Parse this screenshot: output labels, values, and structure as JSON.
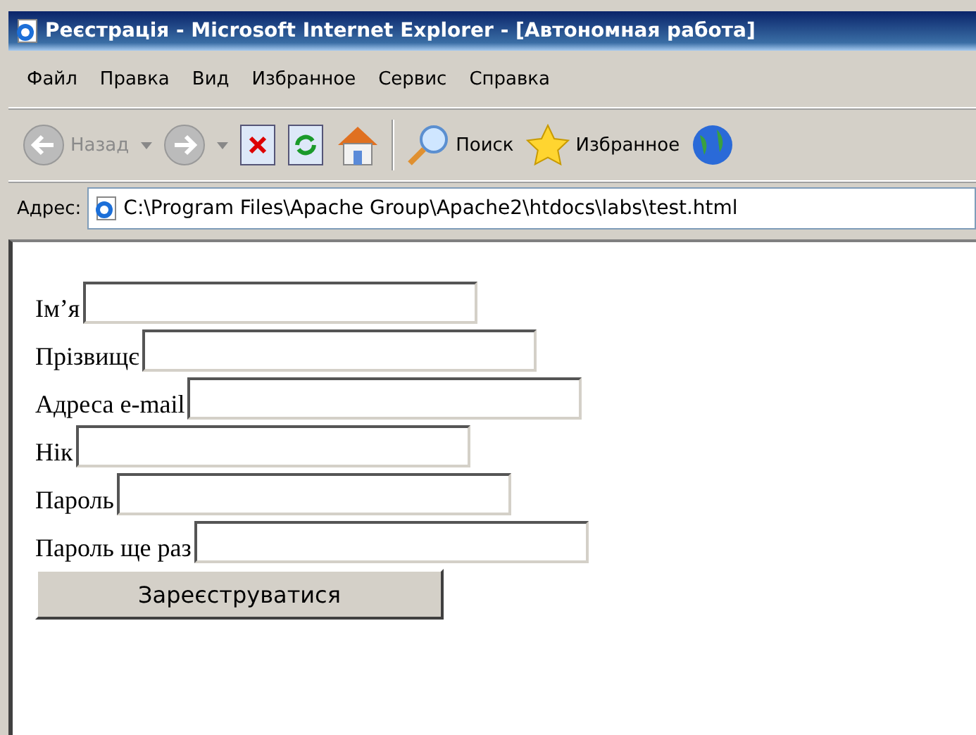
{
  "window": {
    "title": "Реєстрація - Microsoft Internet Explorer - [Автономная работа]"
  },
  "menu": [
    "Файл",
    "Правка",
    "Вид",
    "Избранное",
    "Сервис",
    "Справка"
  ],
  "toolbar": {
    "back": "Назад",
    "search": "Поиск",
    "favorites": "Избранное"
  },
  "address": {
    "label": "Адрес:",
    "value": "C:\\Program Files\\Apache Group\\Apache2\\htdocs\\labs\\test.html"
  },
  "form": {
    "fields": [
      {
        "label": "Ім’я"
      },
      {
        "label": "Прізвищє"
      },
      {
        "label": "Адреса e-mail"
      },
      {
        "label": "Нік"
      },
      {
        "label": "Пароль"
      },
      {
        "label": "Пароль ще раз"
      }
    ],
    "submit": "Зареєструватися"
  }
}
